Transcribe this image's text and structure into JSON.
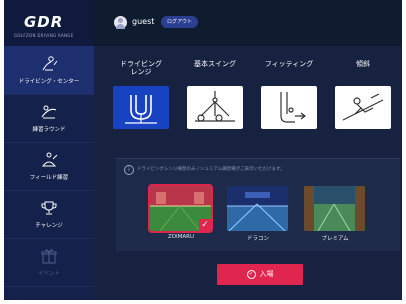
{
  "brand": {
    "logo": "GDR",
    "logo_sub": "GOLFZON DRIVING RANGE"
  },
  "header": {
    "username": "guest",
    "logout_label": "ログアウト"
  },
  "sidebar": {
    "items": [
      {
        "label": "ドライビング・センター",
        "icon": "driving-center-icon",
        "active": true
      },
      {
        "label": "練習ラウンド",
        "icon": "practice-round-icon",
        "active": false
      },
      {
        "label": "フィールド練習",
        "icon": "field-practice-icon",
        "active": false
      },
      {
        "label": "チャレンジ",
        "icon": "challenge-icon",
        "active": false
      },
      {
        "label": "イベント",
        "icon": "event-icon",
        "active": false,
        "disabled": true
      }
    ]
  },
  "tabs": [
    {
      "label": "ドライビング\nレンジ",
      "icon": "driving-range-icon",
      "active": true
    },
    {
      "label": "基本スイング",
      "icon": "basic-swing-icon",
      "active": false
    },
    {
      "label": "フィッティング",
      "icon": "fitting-icon",
      "active": false
    },
    {
      "label": "傾斜",
      "icon": "slope-icon",
      "active": false
    }
  ],
  "info": {
    "text": "ドライビングレンジ練習のみノシュミアム練習場がご表示いただけます。"
  },
  "modes": [
    {
      "label": "ZOIMARU",
      "selected": true
    },
    {
      "label": "ドラコン",
      "selected": false
    },
    {
      "label": "プレミアム",
      "selected": false
    }
  ],
  "enter_button": {
    "label": "入場",
    "color": "#e0254e"
  },
  "colors": {
    "sidebar_bg": "#14214a",
    "main_bg": "#172240",
    "accent_blue": "#1742c2",
    "accent_red": "#e0254e"
  }
}
